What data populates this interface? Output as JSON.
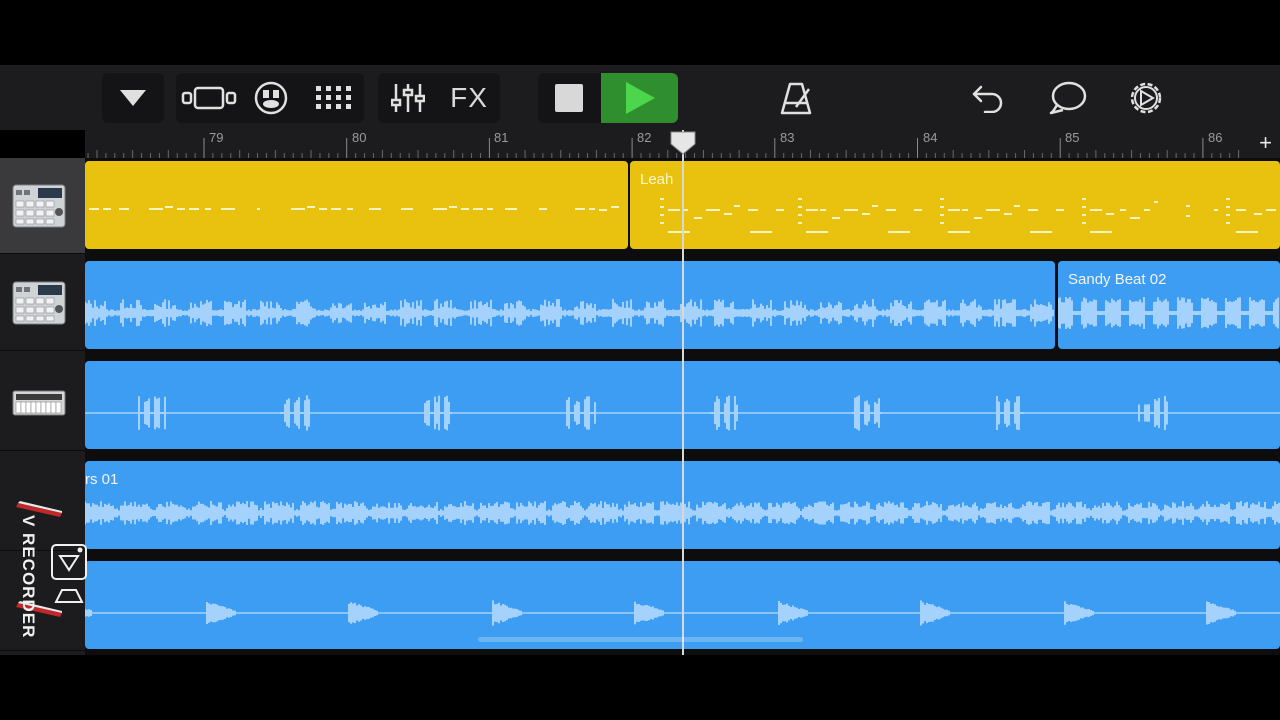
{
  "toolbar": {
    "buttons": [
      {
        "name": "browser-dropdown-icon"
      },
      {
        "name": "tracks-view-icon"
      },
      {
        "name": "instrument-icon"
      },
      {
        "name": "grid-view-icon"
      },
      {
        "name": "mixer-icon"
      },
      {
        "name": "fx-button",
        "label": "FX"
      },
      {
        "name": "stop-icon"
      },
      {
        "name": "play-icon"
      },
      {
        "name": "metronome-icon"
      },
      {
        "name": "undo-icon"
      },
      {
        "name": "loop-icon"
      },
      {
        "name": "settings-icon"
      }
    ],
    "fx_label": "FX",
    "colors": {
      "play_bg": "#2f8f2f",
      "play_glyph": "#4cd64c",
      "toolbar_bg": "#1c1c1e"
    }
  },
  "ruler": {
    "bars": [
      "79",
      "80",
      "81",
      "82",
      "83",
      "84",
      "85",
      "86"
    ],
    "add_label": "+"
  },
  "tracks": [
    {
      "instrument": "drum-machine-icon",
      "selected": true,
      "color": "#e8c20f"
    },
    {
      "instrument": "drum-machine-icon",
      "selected": false,
      "color": "#3d9df2"
    },
    {
      "instrument": "keyboard-synth-icon",
      "selected": false,
      "color": "#3d9df2"
    },
    {
      "instrument": "keyboard-icon",
      "selected": false,
      "color": "#3d9df2"
    },
    {
      "instrument": "keyboard-icon",
      "selected": false,
      "color": "#3d9df2"
    }
  ],
  "regions": {
    "track1": [
      {
        "label": ""
      },
      {
        "label": "Leah"
      }
    ],
    "track2": [
      {
        "label": ""
      },
      {
        "label": "Sandy Beat 02"
      }
    ],
    "track3": [
      {
        "label": ""
      }
    ],
    "track4": [
      {
        "label": "rs 01"
      }
    ],
    "track5": [
      {
        "label": ""
      }
    ]
  },
  "watermark": {
    "text": "V RECORDER"
  }
}
